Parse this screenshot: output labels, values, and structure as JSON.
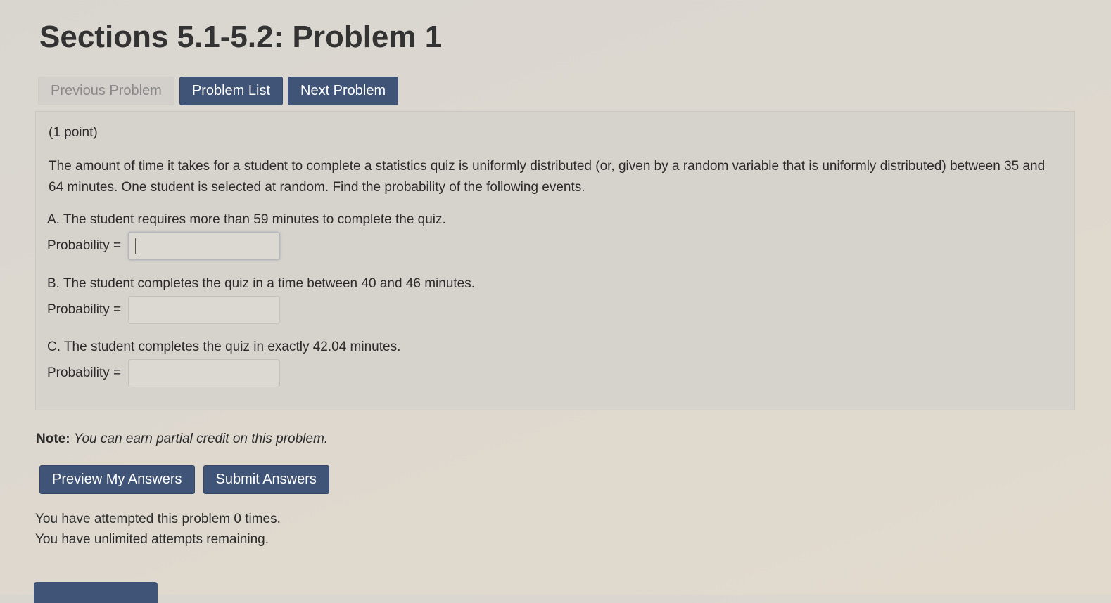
{
  "page": {
    "title": "Sections 5.1-5.2: Problem 1"
  },
  "nav": {
    "previous_label": "Previous Problem",
    "list_label": "Problem List",
    "next_label": "Next Problem"
  },
  "problem": {
    "points": "(1 point)",
    "statement": "The amount of time it takes for a student to complete a statistics quiz is uniformly distributed (or, given by a random variable that is uniformly distributed) between 35 and 64 minutes. One student is selected at random. Find the probability of the following events.",
    "parts": [
      {
        "text": "A. The student requires more than 59 minutes to complete the quiz.",
        "label": "Probability =",
        "value": ""
      },
      {
        "text": "B. The student completes the quiz in a time between 40 and 46 minutes.",
        "label": "Probability =",
        "value": ""
      },
      {
        "text": "C. The student completes the quiz in exactly 42.04 minutes.",
        "label": "Probability =",
        "value": ""
      }
    ]
  },
  "note": {
    "label": "Note:",
    "text": "You can earn partial credit on this problem."
  },
  "actions": {
    "preview_label": "Preview My Answers",
    "submit_label": "Submit Answers"
  },
  "attempts": {
    "line1": "You have attempted this problem 0 times.",
    "line2": "You have unlimited attempts remaining."
  },
  "colors": {
    "primary_button": "#3f5477",
    "disabled_button": "#d3d0cb",
    "problem_background": "#d6d2cc"
  }
}
